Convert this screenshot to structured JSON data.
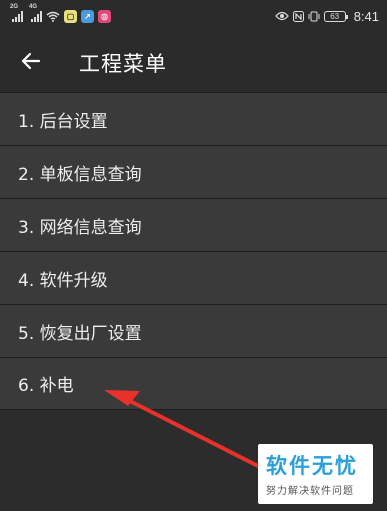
{
  "status_bar": {
    "left_network_1": "2G",
    "left_network_2": "4G",
    "icons": [
      "signal-icon",
      "signal-icon",
      "wifi-icon",
      "app-notification-icon",
      "app-notification-icon",
      "app-notification-icon"
    ],
    "right_icons": [
      "eye-icon",
      "nfc-icon",
      "vibrate-icon"
    ],
    "battery": "63",
    "time": "8:41"
  },
  "app_bar": {
    "title": "工程菜单"
  },
  "menu": {
    "items": [
      {
        "label": "1. 后台设置"
      },
      {
        "label": "2. 单板信息查询"
      },
      {
        "label": "3. 网络信息查询"
      },
      {
        "label": "4. 软件升级"
      },
      {
        "label": "5. 恢复出厂设置"
      },
      {
        "label": "6. 补电"
      }
    ]
  },
  "watermark": {
    "main": "软件无忧",
    "sub": "努力解决软件问题"
  },
  "colors": {
    "background": "#2c2c2c",
    "menu_item": "#3a3a3a",
    "arrow": "#e6322a",
    "watermark_text": "#2a9fd8"
  }
}
